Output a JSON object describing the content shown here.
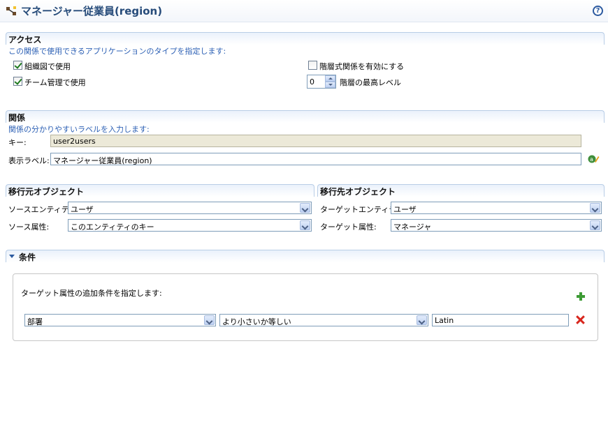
{
  "header": {
    "title": "マネージャー従業員(region)",
    "help_icon": "help-icon",
    "title_icon": "relationship-icon"
  },
  "access": {
    "title": "アクセス",
    "description": "この関係で使用できるアプリケーションのタイプを指定します:",
    "org_chart_label": "組織図で使用",
    "org_chart_checked": true,
    "team_mgmt_label": "チーム管理で使用",
    "team_mgmt_checked": true,
    "hierarchy_label": "階層式関係を有効にする",
    "hierarchy_checked": false,
    "max_level_value": "0",
    "max_level_label": "階層の最高レベル"
  },
  "relationship": {
    "title": "関係",
    "description": "関係の分かりやすいラベルを入力します:",
    "key_label": "キー:",
    "key_value": "user2users",
    "display_label": "表示ラベル:",
    "display_value": "マネージャー従業員(region)"
  },
  "source": {
    "title": "移行元オブジェクト",
    "entity_label": "ソースエンティティ:",
    "entity_value": "ユーザ",
    "attr_label": "ソース属性:",
    "attr_value": "このエンティティのキー"
  },
  "target": {
    "title": "移行先オブジェクト",
    "entity_label": "ターゲットエンティティ:",
    "entity_value": "ユーザ",
    "attr_label": "ターゲット属性:",
    "attr_value": "マネージャ"
  },
  "conditions": {
    "title": "条件",
    "description": "ターゲット属性の追加条件を指定します:",
    "rows": [
      {
        "attribute": "部署",
        "operator": "より小さいか等しい",
        "value": "Latin"
      }
    ]
  },
  "colors": {
    "title": "#264b7a",
    "description": "#2b5fb4",
    "section_border": "#b8cde6",
    "add": "#3d9b35",
    "delete": "#d8261d"
  }
}
